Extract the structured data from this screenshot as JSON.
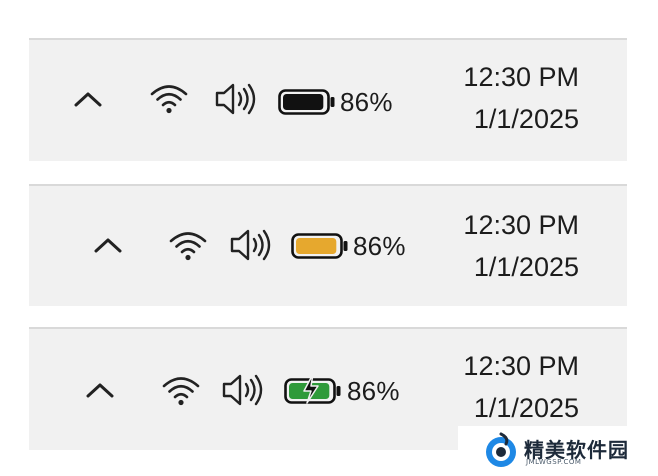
{
  "taskbars": [
    {
      "state": "normal",
      "battery_percent_text": "86%",
      "battery_level": 0.86,
      "battery_color": "#111111",
      "time": "12:30 PM",
      "date": "1/1/2025"
    },
    {
      "state": "battery-saver",
      "battery_percent_text": "86%",
      "battery_level": 0.86,
      "battery_color": "#e6a82e",
      "time": "12:30 PM",
      "date": "1/1/2025"
    },
    {
      "state": "charging",
      "battery_percent_text": "86%",
      "battery_level": 0.86,
      "battery_color": "#2f9a3a",
      "time": "12:30 PM",
      "date": "1/1/2025"
    }
  ],
  "icons": {
    "overflow": "chevron-up-icon",
    "network": "wifi-icon",
    "volume": "speaker-icon",
    "battery": "battery-icon"
  },
  "watermark": {
    "name": "精美软件园",
    "url": "JMLWGSP.COM"
  }
}
